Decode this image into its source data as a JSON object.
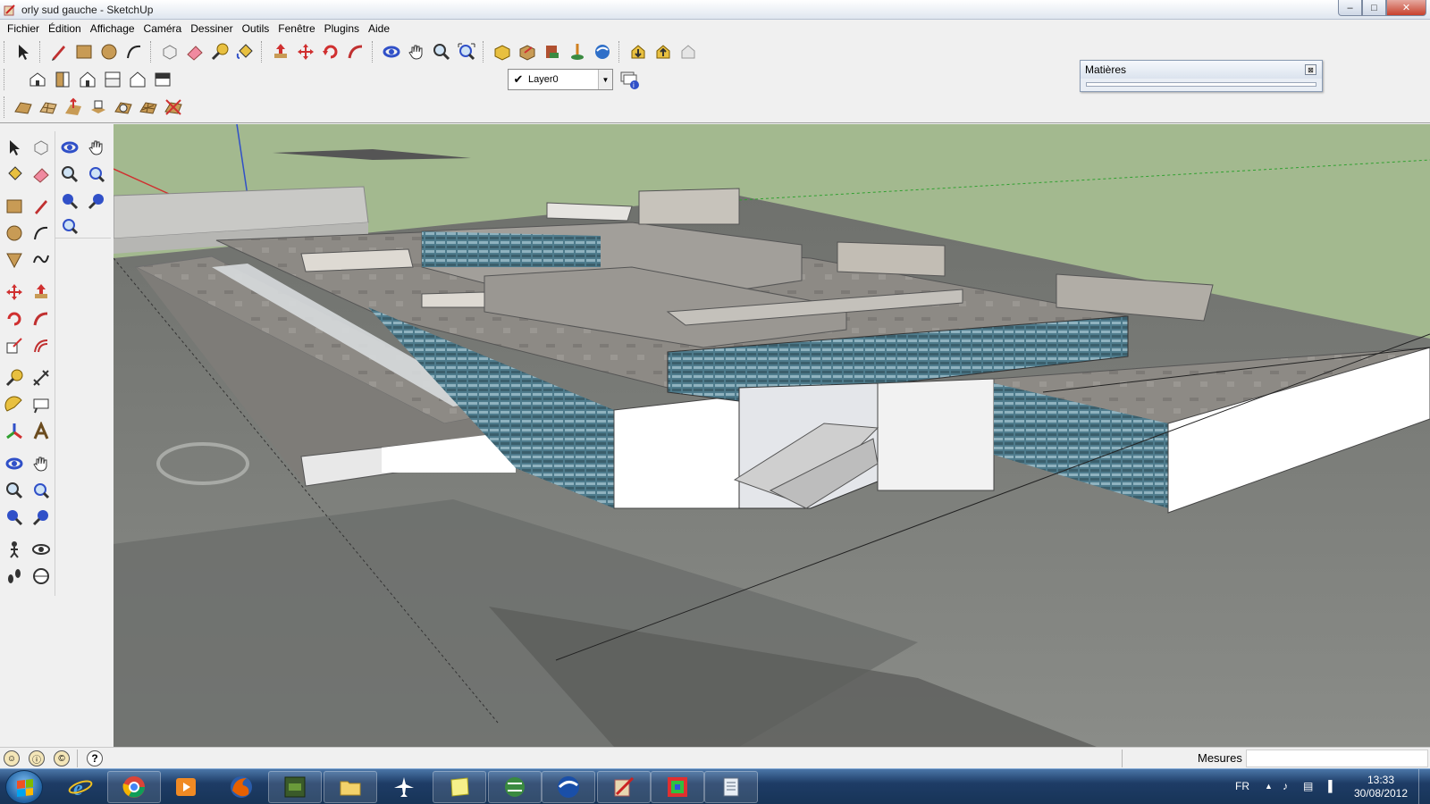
{
  "window": {
    "title": "orly sud gauche - SketchUp",
    "controls": {
      "minimize": "–",
      "maximize": "□",
      "close": "✕"
    }
  },
  "menubar": {
    "items": [
      "Fichier",
      "Édition",
      "Affichage",
      "Caméra",
      "Dessiner",
      "Outils",
      "Fenêtre",
      "Plugins",
      "Aide"
    ]
  },
  "toolbar": {
    "layer_check": "✔",
    "layer_name": "Layer0",
    "layer_arrow": "▼"
  },
  "materials_panel": {
    "title": "Matières",
    "close": "⊠"
  },
  "statusbar": {
    "help": "?",
    "measurements_label": "Mesures",
    "measurements_value": ""
  },
  "taskbar": {
    "language": "FR",
    "time": "13:33",
    "date": "30/08/2012",
    "tray_icons": [
      "▲",
      "♪",
      "▤",
      "▐"
    ]
  },
  "colors": {
    "viewport_sky": "#a3b98f",
    "ground": "#7a7d78",
    "roof": "#8d8a85",
    "wall": "#ffffff",
    "glass": "#4e7b8c",
    "axis_red": "#d03030",
    "axis_blue": "#3050c8",
    "axis_green": "#30a030"
  }
}
